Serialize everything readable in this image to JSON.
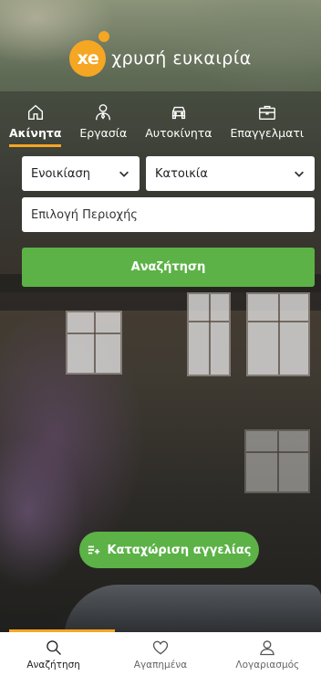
{
  "brand": {
    "logo_text": "xe",
    "tagline": "χρυσή ευκαιρία",
    "accent_color": "#f5a623",
    "green_color": "#5cb247"
  },
  "categories": [
    {
      "label": "Ακίνητα",
      "icon": "home-icon",
      "active": true
    },
    {
      "label": "Εργασία",
      "icon": "person-tie-icon",
      "active": false
    },
    {
      "label": "Αυτοκίνητα",
      "icon": "car-icon",
      "active": false
    },
    {
      "label": "Επαγγελματι",
      "icon": "briefcase-icon",
      "active": false
    }
  ],
  "search": {
    "transaction_value": "Ενοικίαση",
    "property_type_value": "Κατοικία",
    "region_placeholder": "Επιλογή Περιοχής",
    "search_label": "Αναζήτηση"
  },
  "post_ad": {
    "label": "Καταχώριση αγγελίας",
    "icon": "add-list-icon"
  },
  "bottom_nav": [
    {
      "label": "Αναζήτηση",
      "icon": "search-icon",
      "active": true
    },
    {
      "label": "Αγαπημένα",
      "icon": "heart-icon",
      "active": false
    },
    {
      "label": "Λογαριασμός",
      "icon": "user-icon",
      "active": false
    }
  ]
}
